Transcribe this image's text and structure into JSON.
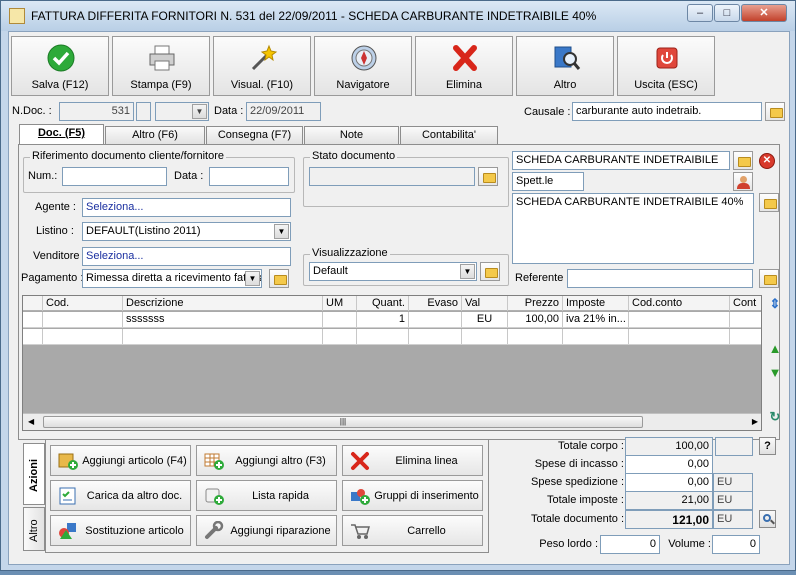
{
  "window": {
    "title": "FATTURA DIFFERITA FORNITORI N. 531  del 22/09/2011 - SCHEDA CARBURANTE  INDETRAIBILE 40%"
  },
  "toolbar": {
    "save": "Salva (F12)",
    "print": "Stampa (F9)",
    "view": "Visual. (F10)",
    "navigator": "Navigatore",
    "delete": "Elimina",
    "other": "Altro",
    "exit": "Uscita (ESC)"
  },
  "header": {
    "ndoc_label": "N.Doc. :",
    "ndoc_value": "531",
    "date_label": "Data :",
    "date_value": "22/09/2011",
    "causale_label": "Causale :",
    "causale_value": "carburante auto indetraib."
  },
  "tabs": [
    "Doc. (F5)",
    "Altro (F6)",
    "Consegna (F7)",
    "Note",
    "Contabilita'"
  ],
  "doc": {
    "ref_group": "Riferimento documento cliente/fornitore",
    "num_label": "Num.:",
    "num_value": "",
    "ref_date_label": "Data :",
    "ref_date_value": "",
    "stato_group": "Stato documento",
    "agente_label": "Agente :",
    "agente_value": "Seleziona...",
    "listino_label": "Listino :",
    "listino_value": "DEFAULT(Listino 2011)",
    "venditore_label": "Venditore :",
    "venditore_value": "Seleziona...",
    "pagamento_label": "Pagamento :",
    "pagamento_value": "Rimessa diretta a ricevimento fattura",
    "visual_group": "Visualizzazione",
    "visual_value": "Default",
    "supplier_name": "SCHEDA CARBURANTE  INDETRAIBILE",
    "salutation": "Spett.le",
    "address": "SCHEDA CARBURANTE  INDETRAIBILE 40%",
    "referente_label": "Referente",
    "referente_value": ""
  },
  "grid": {
    "columns": [
      "Cod.",
      "Descrizione",
      "UM",
      "Quant.",
      "Evaso",
      "Val",
      "Prezzo",
      "Imposte",
      "Cod.conto",
      "Cont"
    ],
    "rows": [
      {
        "cod": "",
        "descrizione": "sssssss",
        "um": "",
        "quant": "1",
        "evaso": "",
        "val": "EU",
        "prezzo": "100,00",
        "imposte": "iva 21% in...",
        "codconto": "",
        "cont": ""
      }
    ]
  },
  "actions": {
    "vtab_active": "Azioni",
    "vtab_other": "Altro",
    "add_article": "Aggiungi articolo (F4)",
    "add_other": "Aggiungi altro (F3)",
    "delete_line": "Elimina linea",
    "load_other_doc": "Carica da altro doc.",
    "quick_list": "Lista rapida",
    "insert_groups": "Gruppi di inserimento",
    "replace_article": "Sostituzione articolo",
    "add_repair": "Aggiungi riparazione",
    "cart": "Carrello"
  },
  "totals": {
    "corpo_label": "Totale corpo :",
    "corpo_value": "100,00",
    "incasso_label": "Spese di incasso :",
    "incasso_value": "0,00",
    "spedizione_label": "Spese spedizione :",
    "spedizione_value": "0,00",
    "imposte_label": "Totale imposte :",
    "imposte_value": "21,00",
    "documento_label": "Totale documento :",
    "documento_value": "121,00",
    "currency": "EU",
    "peso_label": "Peso lordo :",
    "peso_value": "0",
    "volume_label": "Volume :",
    "volume_value": "0",
    "help": "?"
  }
}
